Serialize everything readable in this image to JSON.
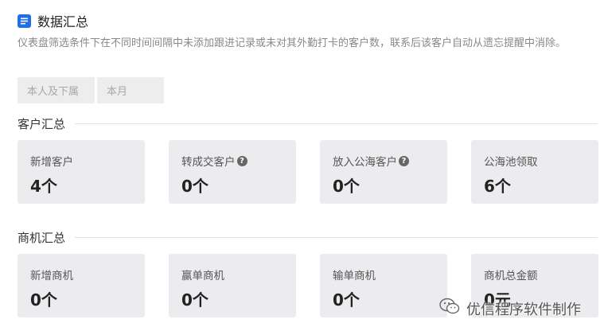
{
  "header": {
    "title": "数据汇总",
    "icon": "document-list-icon",
    "icon_color": "#1f6fe5"
  },
  "description": "仪表盘筛选条件下在不同时间间隔中未添加跟进记录或未对其外勤打卡的客户数，联系后该客户自动从遗忘提醒中消除。",
  "filters": [
    {
      "value": "本人及下属"
    },
    {
      "value": "本月"
    }
  ],
  "customer_summary": {
    "title": "客户汇总",
    "cards": [
      {
        "label": "新增客户",
        "value": "4个",
        "has_help": false
      },
      {
        "label": "转成交客户",
        "value": "0个",
        "has_help": true
      },
      {
        "label": "放入公海客户",
        "value": "0个",
        "has_help": true
      },
      {
        "label": "公海池领取",
        "value": "6个",
        "has_help": false
      }
    ]
  },
  "opportunity_summary": {
    "title": "商机汇总",
    "cards": [
      {
        "label": "新增商机",
        "value": "0个"
      },
      {
        "label": "赢单商机",
        "value": "0个"
      },
      {
        "label": "输单商机",
        "value": "0个"
      },
      {
        "label": "商机总金额",
        "value": "0元"
      }
    ]
  },
  "watermark": {
    "text": "优信程序软件制作",
    "icon": "wechat-icon"
  }
}
